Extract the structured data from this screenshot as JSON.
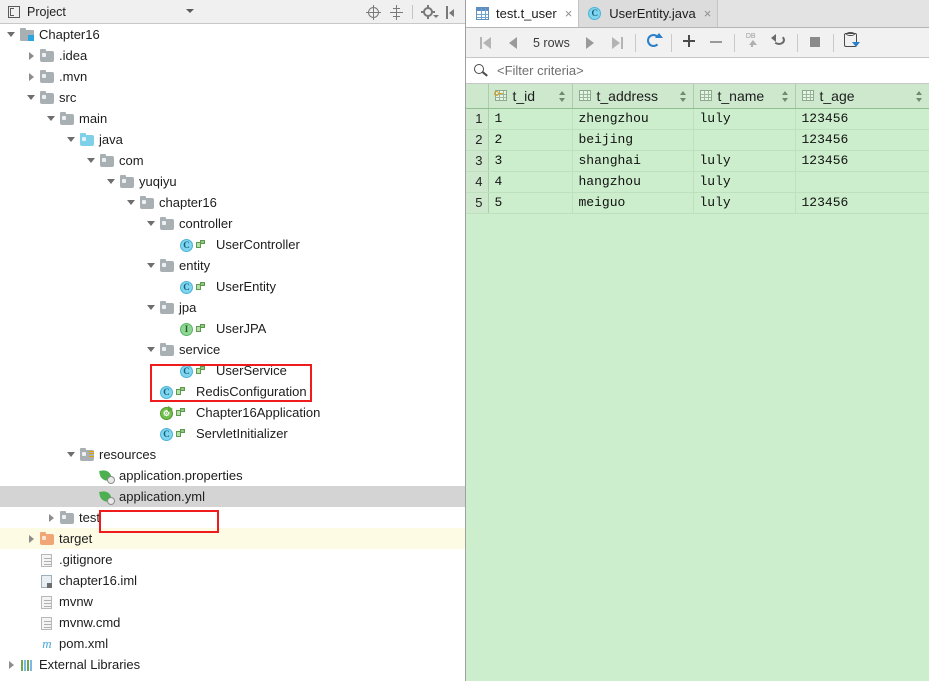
{
  "project_panel": {
    "title": "Project",
    "icon": "project-icon",
    "dropdown_icon": "chevron-down-icon",
    "tools": [
      {
        "name": "locate-icon",
        "label": "Select Opened File"
      },
      {
        "name": "collapse-all-icon",
        "label": "Collapse All"
      },
      {
        "name": "gear-icon",
        "label": "Settings"
      },
      {
        "name": "hide-panel-icon",
        "label": "Hide"
      }
    ],
    "tree": [
      {
        "label": "Chapter16",
        "bold": "[chapter16]",
        "path": "D:\\Chapter16",
        "depth": 0,
        "arrow": "open",
        "icon": "project-module-icon"
      },
      {
        "label": ".idea",
        "depth": 1,
        "arrow": "closed",
        "icon": "folder-icon"
      },
      {
        "label": ".mvn",
        "depth": 1,
        "arrow": "closed",
        "icon": "folder-icon"
      },
      {
        "label": "src",
        "depth": 1,
        "arrow": "open",
        "icon": "folder-icon"
      },
      {
        "label": "main",
        "depth": 2,
        "arrow": "open",
        "icon": "folder-icon"
      },
      {
        "label": "java",
        "depth": 3,
        "arrow": "open",
        "icon": "source-folder-icon"
      },
      {
        "label": "com",
        "depth": 4,
        "arrow": "open",
        "icon": "package-icon"
      },
      {
        "label": "yuqiyu",
        "depth": 5,
        "arrow": "open",
        "icon": "package-icon"
      },
      {
        "label": "chapter16",
        "depth": 6,
        "arrow": "open",
        "icon": "package-icon"
      },
      {
        "label": "controller",
        "depth": 7,
        "arrow": "open",
        "icon": "package-icon"
      },
      {
        "label": "UserController",
        "depth": 8,
        "arrow": "none",
        "icon": "java-class-icon"
      },
      {
        "label": "entity",
        "depth": 7,
        "arrow": "open",
        "icon": "package-icon"
      },
      {
        "label": "UserEntity",
        "depth": 8,
        "arrow": "none",
        "icon": "java-class-icon"
      },
      {
        "label": "jpa",
        "depth": 7,
        "arrow": "open",
        "icon": "package-icon"
      },
      {
        "label": "UserJPA",
        "depth": 8,
        "arrow": "none",
        "icon": "java-interface-icon"
      },
      {
        "label": "service",
        "depth": 7,
        "arrow": "open",
        "icon": "package-icon"
      },
      {
        "label": "UserService",
        "depth": 8,
        "arrow": "none",
        "icon": "java-class-icon"
      },
      {
        "label": "RedisConfiguration",
        "depth": 7,
        "arrow": "none",
        "icon": "java-class-icon"
      },
      {
        "label": "Chapter16Application",
        "depth": 7,
        "arrow": "none",
        "icon": "spring-boot-class-icon"
      },
      {
        "label": "ServletInitializer",
        "depth": 7,
        "arrow": "none",
        "icon": "java-class-icon"
      },
      {
        "label": "resources",
        "depth": 3,
        "arrow": "open",
        "icon": "resources-folder-icon"
      },
      {
        "label": "application.properties",
        "depth": 4,
        "arrow": "none",
        "icon": "spring-config-icon"
      },
      {
        "label": "application.yml",
        "depth": 4,
        "arrow": "none",
        "icon": "spring-config-icon",
        "selected": true
      },
      {
        "label": "test",
        "depth": 2,
        "arrow": "closed",
        "icon": "folder-icon"
      },
      {
        "label": "target",
        "depth": 1,
        "arrow": "closed",
        "icon": "target-folder-icon",
        "tinted": true
      },
      {
        "label": ".gitignore",
        "depth": 1,
        "arrow": "none",
        "icon": "text-file-icon"
      },
      {
        "label": "chapter16.iml",
        "depth": 1,
        "arrow": "none",
        "icon": "iml-file-icon"
      },
      {
        "label": "mvnw",
        "depth": 1,
        "arrow": "none",
        "icon": "text-file-icon"
      },
      {
        "label": "mvnw.cmd",
        "depth": 1,
        "arrow": "none",
        "icon": "text-file-icon"
      },
      {
        "label": "pom.xml",
        "depth": 1,
        "arrow": "none",
        "icon": "maven-file-icon"
      },
      {
        "label": "External Libraries",
        "depth": 0,
        "arrow": "closed",
        "icon": "external-libraries-icon"
      }
    ],
    "annotations": [
      {
        "name": "highlight-service-classes"
      },
      {
        "name": "highlight-application-yml"
      }
    ]
  },
  "editor": {
    "tabs": [
      {
        "label": "test.t_user",
        "icon": "table-icon",
        "active": true,
        "close": "×"
      },
      {
        "label": "UserEntity.java",
        "icon": "java-class-icon",
        "active": false,
        "close": "×"
      }
    ],
    "toolbar": {
      "rows_label": "5 rows",
      "buttons": [
        {
          "name": "first-page-button",
          "icon": "first-page-icon"
        },
        {
          "name": "previous-page-button",
          "icon": "previous-page-icon"
        },
        {
          "name": "next-page-button",
          "icon": "next-page-icon"
        },
        {
          "name": "last-page-button",
          "icon": "last-page-icon"
        },
        {
          "name": "reload-button",
          "icon": "refresh-icon"
        },
        {
          "name": "add-row-button",
          "icon": "plus-icon"
        },
        {
          "name": "delete-row-button",
          "icon": "minus-icon"
        },
        {
          "name": "submit-to-db-button",
          "icon": "db-upload-icon"
        },
        {
          "name": "revert-changes-button",
          "icon": "rollback-icon"
        },
        {
          "name": "cancel-query-button",
          "icon": "stop-icon"
        },
        {
          "name": "edit-source-button",
          "icon": "db-table-icon"
        }
      ]
    },
    "filter": {
      "icon": "filter-search-icon",
      "placeholder": "<Filter criteria>",
      "value": ""
    }
  },
  "chart_data": {
    "type": "table",
    "title": "test.t_user",
    "columns": [
      "t_id",
      "t_address",
      "t_name",
      "t_age"
    ],
    "column_icons": [
      "primary-key-column-icon",
      "column-icon",
      "column-icon",
      "column-icon"
    ],
    "row_numbers": [
      "1",
      "2",
      "3",
      "4",
      "5"
    ],
    "rows": [
      [
        "1",
        "zhengzhou",
        "luly",
        "123456"
      ],
      [
        "2",
        "beijing",
        "",
        "123456"
      ],
      [
        "3",
        "shanghai",
        "luly",
        "123456"
      ],
      [
        "4",
        "hangzhou",
        "luly",
        ""
      ],
      [
        "5",
        "meiguo",
        "luly",
        "123456"
      ]
    ],
    "row_count": 5
  },
  "colors": {
    "grid_background": "#cceecc",
    "header_background": "#cde8cd",
    "annotation": "#ee1c1c",
    "selection": "#d4d4d4",
    "tint": "#fdfbe4"
  }
}
